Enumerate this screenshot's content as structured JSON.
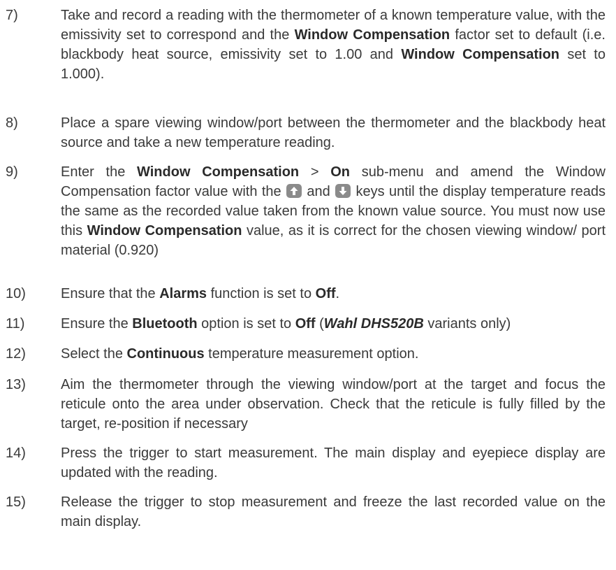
{
  "steps": [
    {
      "num": "7)",
      "parts": [
        {
          "t": "Take and record a reading with the thermometer of a known temperature value, with the emissivity set to correspond and the "
        },
        {
          "t": "Window Compensation",
          "b": true
        },
        {
          "t": " factor set to default (i.e. blackbody heat source, emissivity set to 1.00 and "
        },
        {
          "t": "Window Compensation",
          "b": true
        },
        {
          "t": " set to 1.000)."
        }
      ]
    },
    {
      "num": "8)",
      "parts": [
        {
          "t": "Place a spare viewing window/port between the thermometer and the blackbody heat source and take a new temperature reading."
        }
      ]
    },
    {
      "num": "9)",
      "parts": [
        {
          "t": "Enter the "
        },
        {
          "t": "Window Compensation",
          "b": true
        },
        {
          "t": " > "
        },
        {
          "t": "On",
          "b": true
        },
        {
          "t": " sub-menu and amend the Window Compensation factor value with the "
        },
        {
          "icon": "up-arrow-key-icon"
        },
        {
          "t": " and "
        },
        {
          "icon": "down-arrow-key-icon"
        },
        {
          "t": " keys until the display temperature reads the same as the recorded value taken from the known value source. You must now use this "
        },
        {
          "t": "Window Compensation",
          "b": true
        },
        {
          "t": " value, as it is correct for the chosen viewing window/ port material (0.920)"
        }
      ]
    },
    {
      "num": "10)",
      "parts": [
        {
          "t": "Ensure that the "
        },
        {
          "t": "Alarms",
          "b": true
        },
        {
          "t": " function is set to "
        },
        {
          "t": "Off",
          "b": true
        },
        {
          "t": "."
        }
      ]
    },
    {
      "num": "11)",
      "parts": [
        {
          "t": "Ensure the "
        },
        {
          "t": "Bluetooth",
          "b": true
        },
        {
          "t": " option is set to "
        },
        {
          "t": "Off",
          "b": true
        },
        {
          "t": " ("
        },
        {
          "t": "Wahl DHS520B",
          "b": true,
          "i": true
        },
        {
          "t": " variants only)"
        }
      ]
    },
    {
      "num": "12)",
      "parts": [
        {
          "t": "Select the "
        },
        {
          "t": "Continuous",
          "b": true
        },
        {
          "t": " temperature measurement option."
        }
      ]
    },
    {
      "num": "13)",
      "parts": [
        {
          "t": "Aim the thermometer through the viewing window/port at the target and focus the reticule onto the area under observation. Check that the reticule is fully filled by the target, re-position if necessary"
        }
      ]
    },
    {
      "num": "14)",
      "parts": [
        {
          "t": "Press the trigger to start measurement. The main display and eyepiece display are updated with the reading."
        }
      ]
    },
    {
      "num": "15)",
      "parts": [
        {
          "t": "Release the trigger to stop measurement and freeze the last recorded value on the main display."
        }
      ]
    }
  ]
}
